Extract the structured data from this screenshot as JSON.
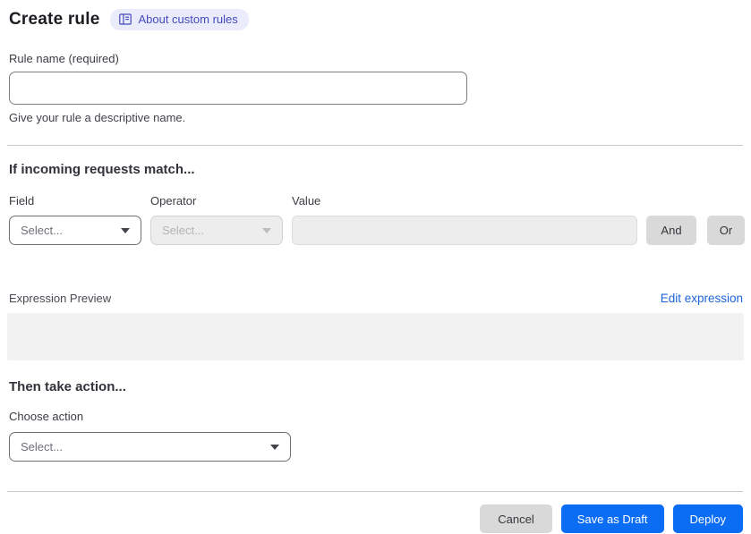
{
  "header": {
    "title": "Create rule",
    "badge_label": "About custom rules"
  },
  "rule_name": {
    "label": "Rule name (required)",
    "value": "",
    "helper": "Give your rule a descriptive name."
  },
  "match_section": {
    "heading": "If incoming requests match...",
    "field": {
      "label": "Field",
      "placeholder": "Select..."
    },
    "operator": {
      "label": "Operator",
      "placeholder": "Select...",
      "disabled": true
    },
    "value": {
      "label": "Value",
      "value": "",
      "disabled": true
    },
    "and_button": "And",
    "or_button": "Or",
    "expression_preview_label": "Expression Preview",
    "edit_expression_link": "Edit expression",
    "expression_value": ""
  },
  "action_section": {
    "heading": "Then take action...",
    "choose_action_label": "Choose action",
    "action_placeholder": "Select..."
  },
  "footer": {
    "cancel_label": "Cancel",
    "save_draft_label": "Save as Draft",
    "deploy_label": "Deploy"
  },
  "colors": {
    "primary_blue": "#0b6cf4",
    "link_blue": "#1c64da",
    "badge_bg": "#ebecfb",
    "badge_text": "#4449bd",
    "disabled_bg": "#ededed",
    "neutral_button_bg": "#d9d9d9",
    "preview_box_bg": "#f2f2f2"
  }
}
